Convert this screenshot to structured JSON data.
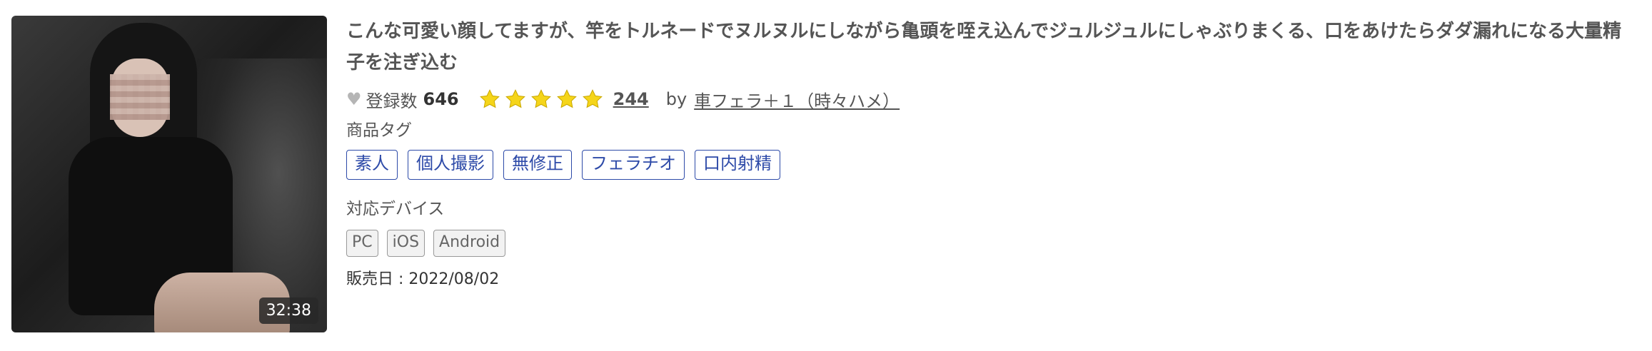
{
  "product": {
    "title": "こんな可愛い顔してますが、竿をトルネードでヌルヌルにしながら亀頭を咥え込んでジュルジュルにしゃぶりまくる、口をあけたらダダ漏れになる大量精子を注ぎ込む",
    "duration": "32:38",
    "favorites_label": "登録数",
    "favorites_count": "646",
    "rating_stars": 5,
    "review_count": "244",
    "by_label": "by",
    "author": "車フェラ＋１（時々ハメ）",
    "tags_label": "商品タグ",
    "tags": [
      "素人",
      "個人撮影",
      "無修正",
      "フェラチオ",
      "口内射精"
    ],
    "devices_label": "対応デバイス",
    "devices": [
      "PC",
      "iOS",
      "Android"
    ],
    "release_text": "販売日 : 2022/08/02"
  },
  "colors": {
    "tag_blue": "#2d4aa8",
    "star_yellow": "#f5d51a",
    "heart_gray": "#b5b5b5"
  },
  "icons": {
    "favorite": "heart-icon",
    "rating": "star-icon"
  }
}
